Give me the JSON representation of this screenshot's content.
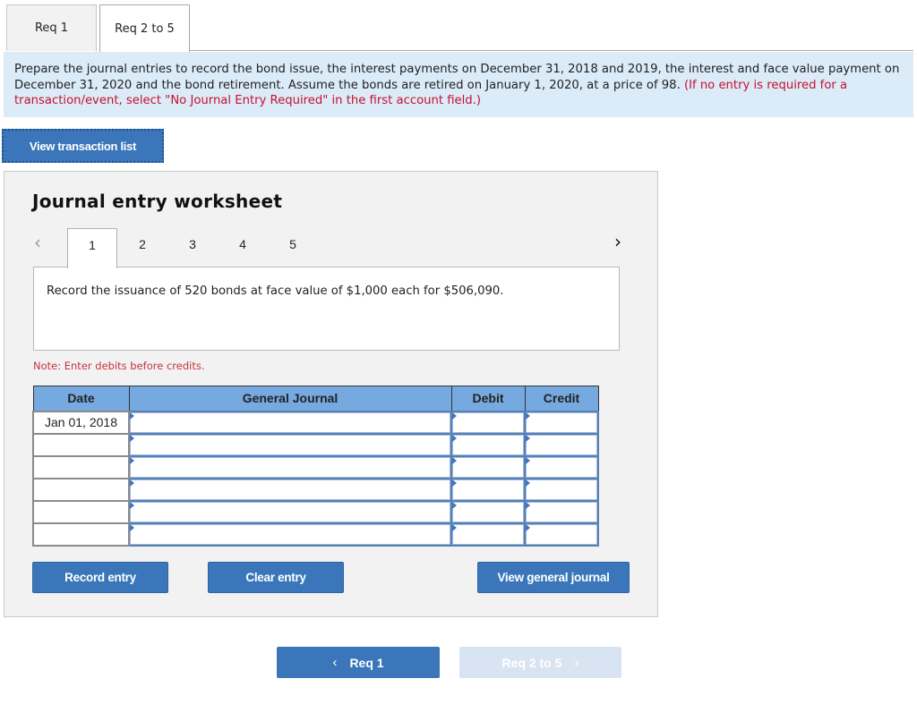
{
  "tabs": [
    {
      "label": "Req 1",
      "active": false
    },
    {
      "label": "Req 2 to 5",
      "active": true
    }
  ],
  "instructions": {
    "text": "Prepare the journal entries to record the bond issue, the interest payments on December 31, 2018 and 2019,  the interest and face value payment on December 31, 2020 and the bond retirement. Assume the bonds are retired on January 1, 2020, at a price of  98. ",
    "red_text": "(If no entry is required for a transaction/event, select \"No Journal Entry Required\" in the first account field.)"
  },
  "view_transaction_list_label": "View transaction list",
  "worksheet": {
    "title": "Journal entry worksheet",
    "prev_icon": "chevron-left-icon",
    "next_icon": "chevron-right-icon",
    "steps": [
      "1",
      "2",
      "3",
      "4",
      "5"
    ],
    "active_step": "1",
    "description": "Record the issuance of 520 bonds at face value of $1,000 each for $506,090.",
    "note": "Note: Enter debits before credits.",
    "table": {
      "headers": {
        "date": "Date",
        "general_journal": "General Journal",
        "debit": "Debit",
        "credit": "Credit"
      },
      "rows": [
        {
          "date": "Jan 01, 2018",
          "account": "",
          "debit": "",
          "credit": ""
        },
        {
          "date": "",
          "account": "",
          "debit": "",
          "credit": ""
        },
        {
          "date": "",
          "account": "",
          "debit": "",
          "credit": ""
        },
        {
          "date": "",
          "account": "",
          "debit": "",
          "credit": ""
        },
        {
          "date": "",
          "account": "",
          "debit": "",
          "credit": ""
        },
        {
          "date": "",
          "account": "",
          "debit": "",
          "credit": ""
        }
      ]
    },
    "buttons": {
      "record": "Record entry",
      "clear": "Clear entry",
      "view_general_journal": "View general journal"
    }
  },
  "footer_nav": {
    "prev_label": "Req 1",
    "next_label": "Req 2 to 5",
    "prev_icon": "‹",
    "next_icon": "›"
  },
  "colors": {
    "button_blue": "#3a76b9",
    "header_blue": "#75a9e0",
    "instruction_bg": "#dbebf8",
    "warning_red": "#c8102e",
    "disabled_button": "#d9e4f2"
  }
}
